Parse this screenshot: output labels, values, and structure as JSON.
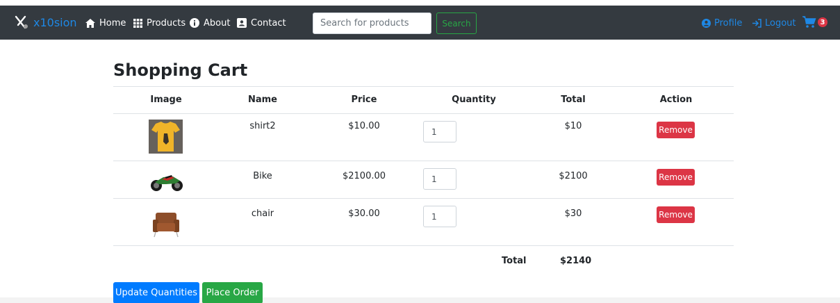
{
  "navbar": {
    "brand": "x10sion",
    "links": [
      "Home",
      "Products",
      "About",
      "Contact"
    ],
    "search_placeholder": "Search for products",
    "search_button": "Search",
    "profile": "Profile",
    "logout": "Logout",
    "cart_count": "3"
  },
  "cart": {
    "title": "Shopping Cart",
    "columns": [
      "Image",
      "Name",
      "Price",
      "Quantity",
      "Total",
      "Action"
    ],
    "items": [
      {
        "image": "tshirt-image",
        "name": "shirt2",
        "price": "$10.00",
        "quantity": "1",
        "total": "$10",
        "action": "Remove"
      },
      {
        "image": "motorbike-image",
        "name": "Bike",
        "price": "$2100.00",
        "quantity": "1",
        "total": "$2100",
        "action": "Remove"
      },
      {
        "image": "chair-image",
        "name": "chair",
        "price": "$30.00",
        "quantity": "1",
        "total": "$30",
        "action": "Remove"
      }
    ],
    "total_label": "Total",
    "total_value": "$2140"
  },
  "actions": {
    "update": "Update Quantities",
    "place_order": "Place Order"
  },
  "colors": {
    "navbar_bg": "#343a40",
    "brand_blue": "#1e88e5",
    "danger": "#dc3545",
    "primary": "#007bff",
    "success": "#28a745"
  }
}
